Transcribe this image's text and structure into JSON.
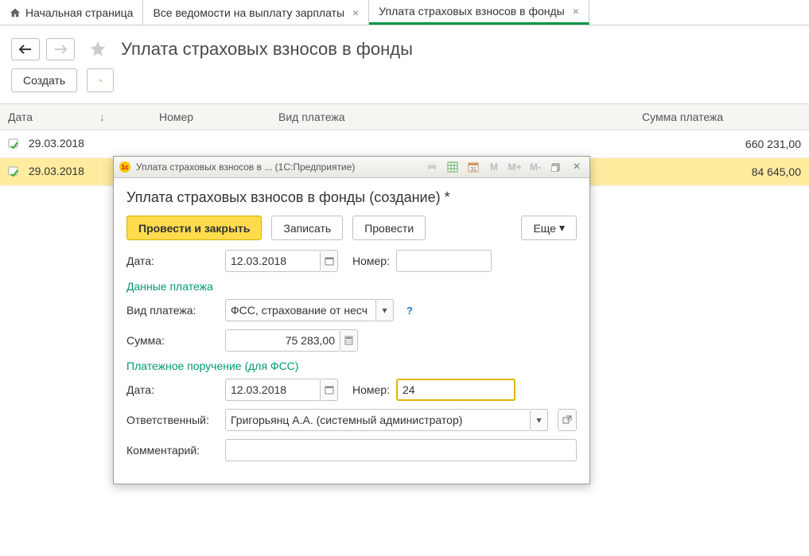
{
  "tabs": [
    {
      "label": "Начальная страница",
      "closable": false
    },
    {
      "label": "Все ведомости на выплату зарплаты",
      "closable": true
    },
    {
      "label": "Уплата страховых взносов в фонды",
      "closable": true,
      "active": true
    }
  ],
  "page": {
    "title": "Уплата страховых взносов в фонды",
    "create_label": "Создать"
  },
  "columns": {
    "date": "Дата",
    "number": "Номер",
    "type": "Вид платежа",
    "sum": "Сумма платежа"
  },
  "rows": [
    {
      "date": "29.03.2018",
      "sum": "660 231,00"
    },
    {
      "date": "29.03.2018",
      "sum": "84 645,00",
      "selected": true
    }
  ],
  "dialog": {
    "window_title": "Уплата страховых взносов в ... (1С:Предприятие)",
    "heading": "Уплата страховых взносов в фонды (создание) *",
    "buttons": {
      "post_close": "Провести и закрыть",
      "save": "Записать",
      "post": "Провести",
      "more": "Еще"
    },
    "fields": {
      "date_label": "Дата:",
      "date_value": "12.03.2018",
      "number_label": "Номер:",
      "number_value": "",
      "section_payment": "Данные платежа",
      "type_label": "Вид платежа:",
      "type_value": "ФСС, страхование от несч",
      "sum_label": "Сумма:",
      "sum_value": "75 283,00",
      "section_order": "Платежное поручение (для ФСС)",
      "order_date_label": "Дата:",
      "order_date_value": "12.03.2018",
      "order_num_label": "Номер:",
      "order_num_value": "24",
      "responsible_label": "Ответственный:",
      "responsible_value": "Григорьянц А.А. (системный администратор)",
      "comment_label": "Комментарий:",
      "comment_value": ""
    }
  }
}
